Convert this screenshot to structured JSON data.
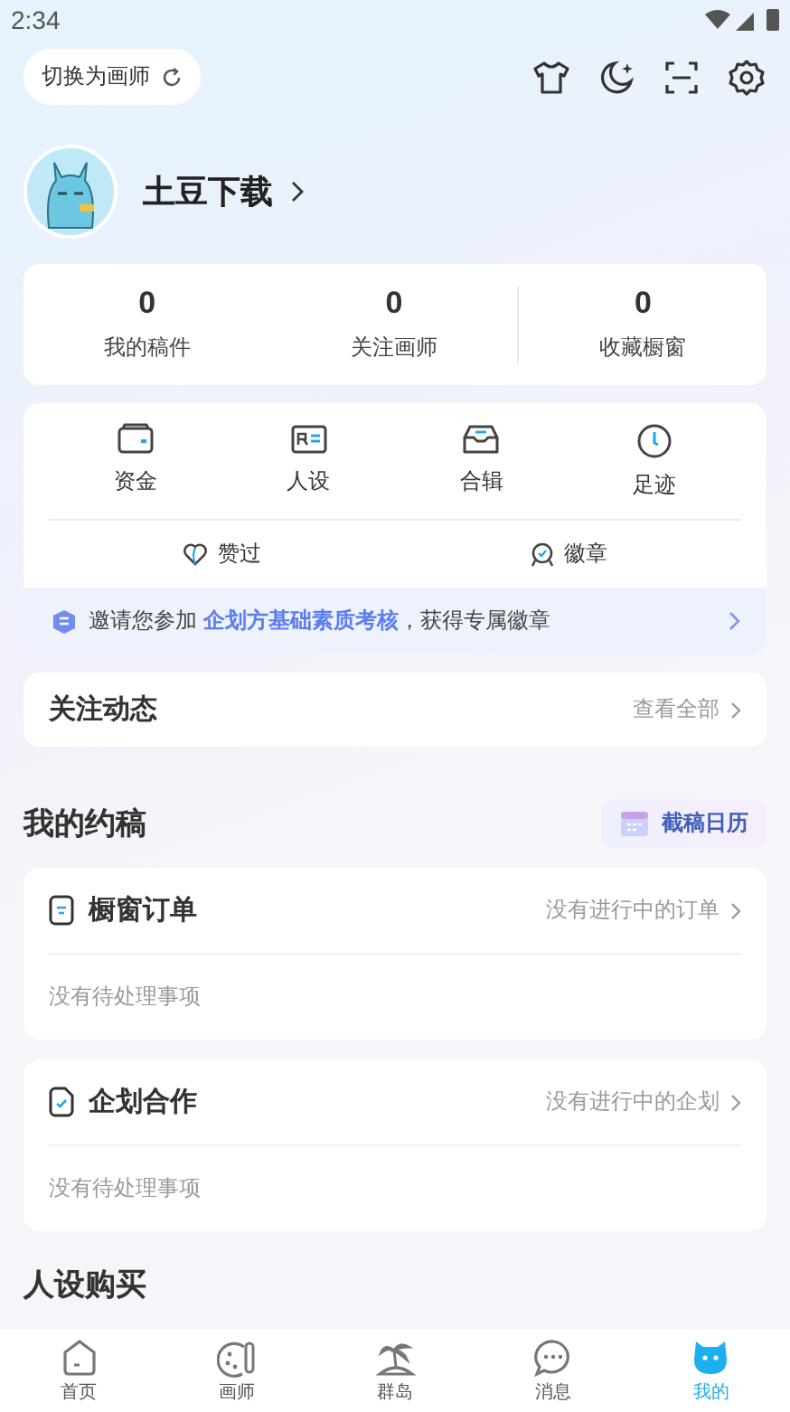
{
  "status_bar": {
    "time": "2:34"
  },
  "top_bar": {
    "switch_button": "切换为画师"
  },
  "profile": {
    "name": "土豆下载"
  },
  "stats": [
    {
      "value": "0",
      "label": "我的稿件"
    },
    {
      "value": "0",
      "label": "关注画师"
    },
    {
      "value": "0",
      "label": "收藏橱窗"
    }
  ],
  "shortcuts": [
    {
      "label": "资金"
    },
    {
      "label": "人设"
    },
    {
      "label": "合辑"
    },
    {
      "label": "足迹"
    }
  ],
  "secondary_links": [
    {
      "label": "赞过"
    },
    {
      "label": "徽章"
    }
  ],
  "invite_banner": {
    "before": "邀请您参加 ",
    "link": "企划方基础素质考核",
    "after": "，获得专属徽章"
  },
  "following": {
    "title": "关注动态",
    "link": "查看全部"
  },
  "commissions": {
    "title": "我的约稿",
    "calendar_button": "截稿日历",
    "cards": [
      {
        "title": "橱窗订单",
        "status": "没有进行中的订单",
        "empty": "没有待处理事项"
      },
      {
        "title": "企划合作",
        "status": "没有进行中的企划",
        "empty": "没有待处理事项"
      }
    ]
  },
  "next_section": {
    "title": "人设购买"
  },
  "nav": [
    {
      "label": "首页",
      "selected": false
    },
    {
      "label": "画师",
      "selected": false
    },
    {
      "label": "群岛",
      "selected": false
    },
    {
      "label": "消息",
      "selected": false
    },
    {
      "label": "我的",
      "selected": true
    }
  ]
}
